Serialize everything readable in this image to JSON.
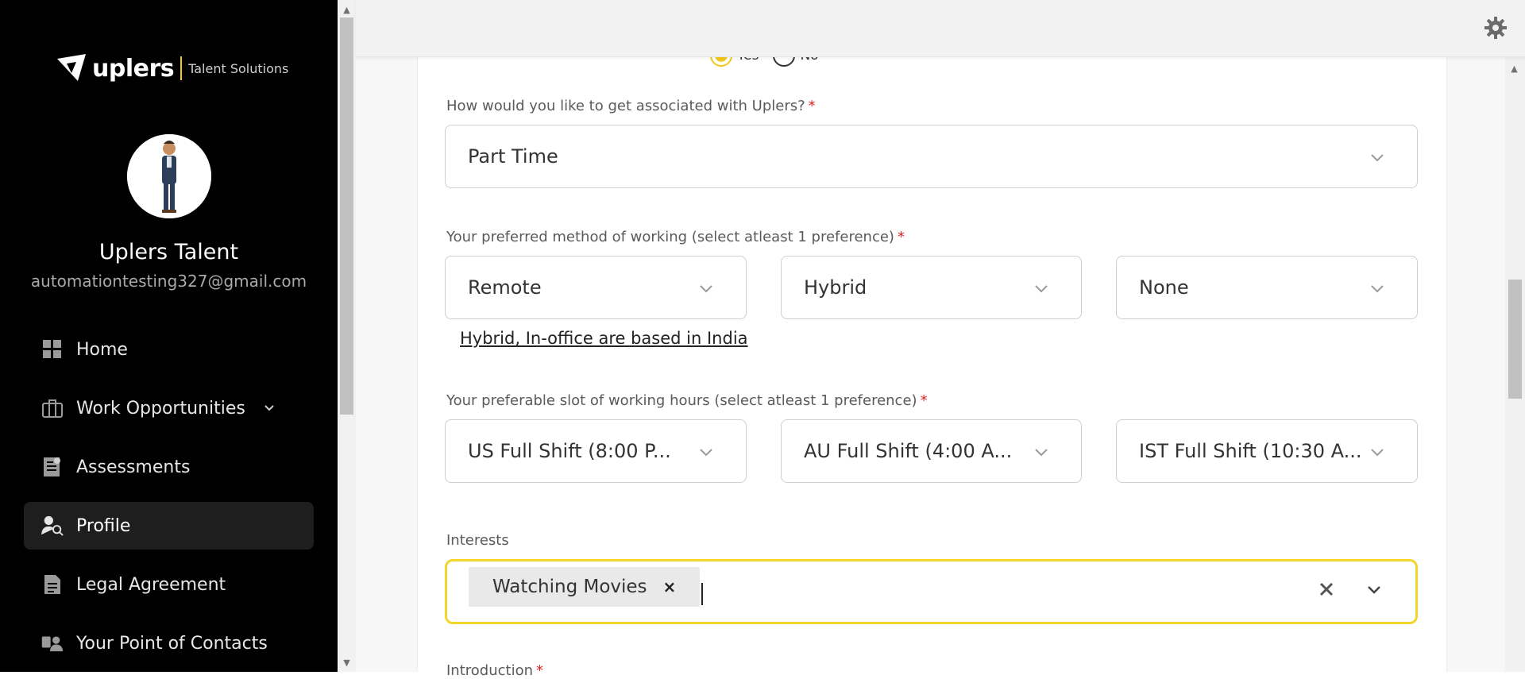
{
  "sidebar": {
    "logo_word": "uplers",
    "logo_sub": "Talent Solutions",
    "user_name": "Uplers Talent",
    "user_email": "automationtesting327@gmail.com",
    "items": [
      {
        "label": "Home",
        "icon": "grid-icon"
      },
      {
        "label": "Work Opportunities",
        "icon": "briefcase-icon",
        "has_chevron": true
      },
      {
        "label": "Assessments",
        "icon": "assessment-icon"
      },
      {
        "label": "Profile",
        "icon": "profile-search-icon",
        "active": true
      },
      {
        "label": "Legal Agreement",
        "icon": "document-icon"
      },
      {
        "label": "Your Point of Contacts",
        "icon": "contacts-icon"
      }
    ]
  },
  "form": {
    "international_clients": {
      "yes": "Yes",
      "no": "No",
      "selected": "Yes"
    },
    "association": {
      "label": "How would you like to get associated with Uplers?",
      "value": "Part Time"
    },
    "working_method": {
      "label": "Your preferred method of working (select atleast 1 preference)",
      "values": [
        "Remote",
        "Hybrid",
        "None"
      ],
      "note": "Hybrid, In-office are based in India"
    },
    "working_hours": {
      "label": "Your preferable slot of working hours (select atleast 1 preference)",
      "values": [
        "US Full Shift (8:00 P...",
        "AU Full Shift (4:00 A...",
        "IST Full Shift (10:30 A..."
      ]
    },
    "interests": {
      "label": "Interests",
      "chips": [
        "Watching Movies"
      ]
    },
    "introduction": {
      "label": "Introduction"
    }
  },
  "colors": {
    "accent": "#f4c81c",
    "sidebar_bg": "#000000",
    "required": "#e02020"
  }
}
